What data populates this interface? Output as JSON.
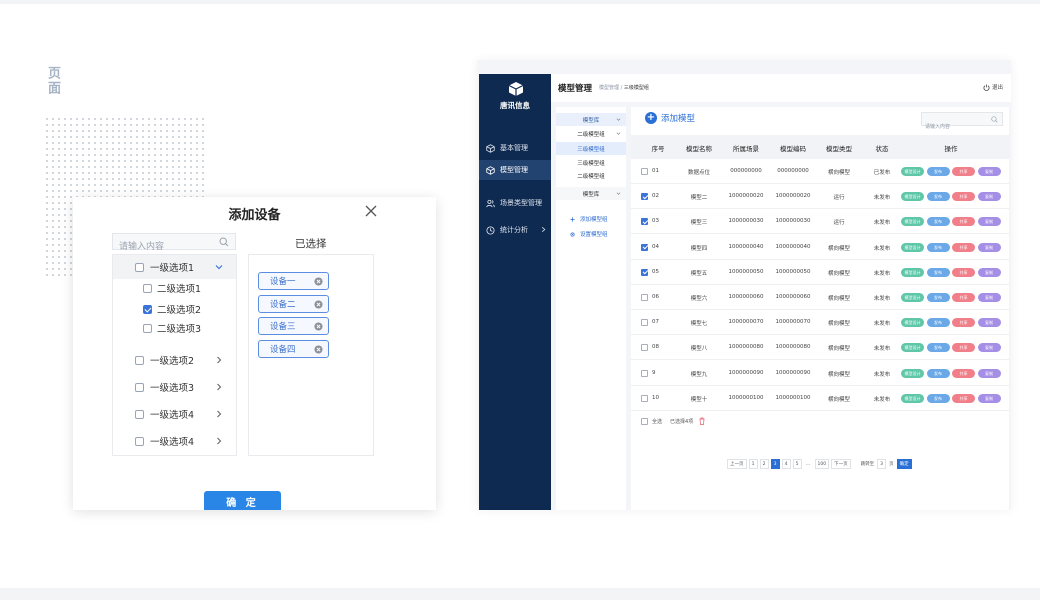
{
  "page_label": "页面",
  "dialog": {
    "title": "添加设备",
    "search_placeholder": "请输入内容",
    "tree": [
      {
        "label": "一级选项1",
        "level": 1,
        "checked": false,
        "expanded": true
      },
      {
        "label": "二级选项1",
        "level": 2,
        "checked": false
      },
      {
        "label": "二级选项2",
        "level": 2,
        "checked": true
      },
      {
        "label": "二级选项3",
        "level": 2,
        "checked": false
      },
      {
        "label": "一级选项2",
        "level": 1,
        "checked": false
      },
      {
        "label": "一级选项3",
        "level": 1,
        "checked": false
      },
      {
        "label": "一级选项4",
        "level": 1,
        "checked": false
      },
      {
        "label": "一级选项4",
        "level": 1,
        "checked": false
      }
    ],
    "selected_title": "已选择",
    "selected_tags": [
      "设备一",
      "设备二",
      "设备三",
      "设备四"
    ],
    "confirm_label": "确 定"
  },
  "app": {
    "brand": "唐讯信息",
    "nav": [
      {
        "label": "基本管理",
        "icon": "cube-outline-icon",
        "active": false
      },
      {
        "label": "模型管理",
        "icon": "cube-icon",
        "active": true
      },
      {
        "label": "场景类型管理",
        "icon": "users-icon",
        "active": false
      },
      {
        "label": "统计分析",
        "icon": "clock-icon",
        "active": false,
        "has_submenu": true
      }
    ],
    "header": {
      "title": "模型管理",
      "breadcrumb_parent": "模型管理",
      "breadcrumb_sep": " / ",
      "breadcrumb_current": "三级模型组",
      "logout": "退出"
    },
    "model_tree": [
      {
        "label": "模型库",
        "type": "lib"
      },
      {
        "label": "二级模型组",
        "type": "item"
      },
      {
        "label": "三级模型组",
        "type": "sel"
      },
      {
        "label": "三级模型组",
        "type": "item"
      },
      {
        "label": "二级模型组",
        "type": "item"
      },
      {
        "label": "模型库",
        "type": "lib2"
      }
    ],
    "tree_actions": [
      "添加模型组",
      "设置模型组"
    ],
    "add_model": "添加模型",
    "search_placeholder": "请输入内容",
    "columns": [
      "序号",
      "模型名称",
      "所属场景",
      "模型编码",
      "模型类型",
      "状态",
      "操作"
    ],
    "rows": [
      {
        "seq": "01",
        "name": "数据点位",
        "scene": "000000000",
        "code": "000000000",
        "type": "横向模型",
        "status": "已发布",
        "checked": false
      },
      {
        "seq": "02",
        "name": "模型二",
        "scene": "1000000020",
        "code": "1000000020",
        "type": "运行",
        "status": "未发布",
        "checked": true
      },
      {
        "seq": "03",
        "name": "模型三",
        "scene": "1000000030",
        "code": "1000000030",
        "type": "运行",
        "status": "未发布",
        "checked": true
      },
      {
        "seq": "04",
        "name": "模型四",
        "scene": "1000000040",
        "code": "1000000040",
        "type": "横向模型",
        "status": "未发布",
        "checked": true
      },
      {
        "seq": "05",
        "name": "模型五",
        "scene": "1000000050",
        "code": "1000000050",
        "type": "横向模型",
        "status": "未发布",
        "checked": true
      },
      {
        "seq": "06",
        "name": "模型六",
        "scene": "1000000060",
        "code": "1000000060",
        "type": "横向模型",
        "status": "未发布",
        "checked": false
      },
      {
        "seq": "07",
        "name": "模型七",
        "scene": "1000000070",
        "code": "1000000070",
        "type": "横向模型",
        "status": "未发布",
        "checked": false
      },
      {
        "seq": "08",
        "name": "模型八",
        "scene": "1000000080",
        "code": "1000000080",
        "type": "横向模型",
        "status": "未发布",
        "checked": false
      },
      {
        "seq": "9",
        "name": "模型九",
        "scene": "1000000090",
        "code": "1000000090",
        "type": "横向模型",
        "status": "未发布",
        "checked": false
      },
      {
        "seq": "10",
        "name": "模型十",
        "scene": "1000000100",
        "code": "1000000100",
        "type": "横向模型",
        "status": "未发布",
        "checked": false
      }
    ],
    "row_actions": [
      {
        "label": "模型设计",
        "color": "#5fc7a8"
      },
      {
        "label": "发布",
        "color": "#6aa8e8"
      },
      {
        "label": "共享",
        "color": "#f07f8a"
      },
      {
        "label": "复制",
        "color": "#a48ee6"
      }
    ],
    "batch": {
      "select_all": "全选",
      "selected_count": "已选择4项"
    },
    "pager": {
      "prev": "上一页",
      "pages": [
        "1",
        "2",
        "3",
        "4",
        "5",
        "...",
        "100"
      ],
      "current": "3",
      "next": "下一页",
      "goto_prefix": "跳转至",
      "goto_value": "3",
      "goto_suffix": "页",
      "confirm": "确定"
    }
  }
}
